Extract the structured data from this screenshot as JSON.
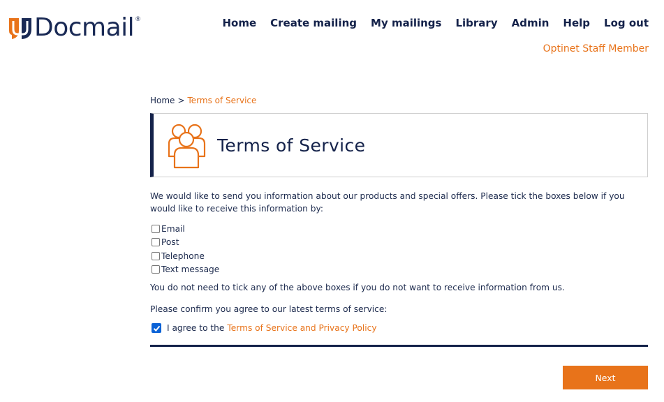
{
  "brand": {
    "name": "Docmail",
    "reg": "®",
    "primary": "#1a2a55",
    "accent": "#e8731a"
  },
  "nav": [
    "Home",
    "Create mailing",
    "My mailings",
    "Library",
    "Admin",
    "Help",
    "Log out"
  ],
  "user_role": "Optinet Staff Member",
  "breadcrumb": {
    "home": "Home",
    "sep": ">",
    "current": "Terms of Service"
  },
  "page_title": "Terms of Service",
  "title_icon": "people-group-icon",
  "intro": "We would like to send you information about our products and special offers. Please tick the boxes below if you would like to receive this information by:",
  "options": [
    {
      "label": "Email",
      "checked": false
    },
    {
      "label": "Post",
      "checked": false
    },
    {
      "label": "Telephone",
      "checked": false
    },
    {
      "label": "Text message",
      "checked": false
    }
  ],
  "note": "You do not need to tick any of the above boxes if you do not want to receive information from us.",
  "confirm_prompt": "Please confirm you agree to our latest terms of service:",
  "agree": {
    "prefix": "I agree to the",
    "link": "Terms of Service and Privacy Policy",
    "checked": true
  },
  "next_label": "Next"
}
